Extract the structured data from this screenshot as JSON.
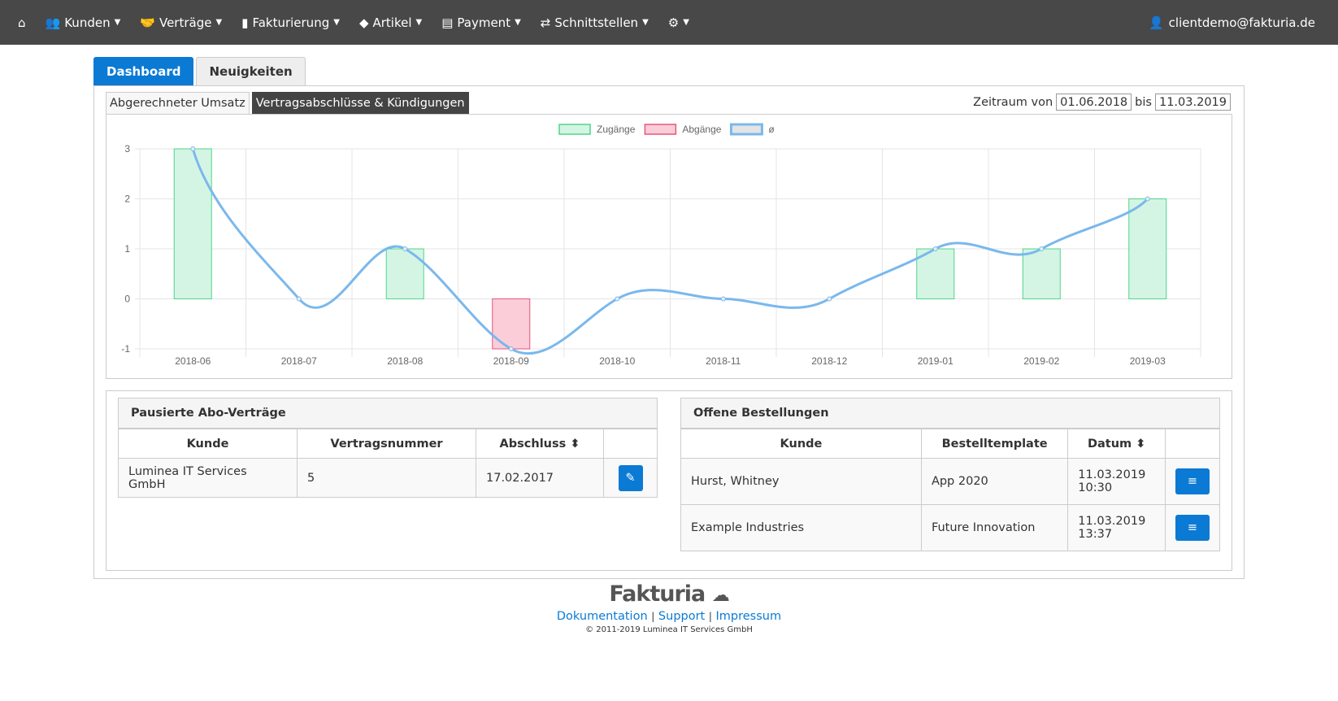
{
  "nav": {
    "items": [
      {
        "label": "Kunden",
        "icon": "users-icon"
      },
      {
        "label": "Verträge",
        "icon": "handshake-icon"
      },
      {
        "label": "Fakturierung",
        "icon": "book-icon"
      },
      {
        "label": "Artikel",
        "icon": "tags-icon"
      },
      {
        "label": "Payment",
        "icon": "credit-card-icon"
      },
      {
        "label": "Schnittstellen",
        "icon": "exchange-icon"
      }
    ],
    "user": "clientdemo@fakturia.de"
  },
  "tabs": [
    "Dashboard",
    "Neuigkeiten"
  ],
  "subtabs": [
    "Abgerechneter Umsatz",
    "Vertragsabschlüsse & Kündigungen"
  ],
  "range": {
    "label_from": "Zeitraum von",
    "from": "01.06.2018",
    "label_to": "bis",
    "to": "11.03.2019"
  },
  "chart_data": {
    "type": "bar",
    "categories": [
      "2018-06",
      "2018-07",
      "2018-08",
      "2018-09",
      "2018-10",
      "2018-11",
      "2018-12",
      "2019-01",
      "2019-02",
      "2019-03"
    ],
    "series": [
      {
        "name": "Zugänge",
        "type": "bar",
        "values": [
          3,
          0,
          1,
          0,
          0,
          0,
          0,
          1,
          1,
          2
        ],
        "color": "#d4f5e4",
        "border": "#4fd58a"
      },
      {
        "name": "Abgänge",
        "type": "bar",
        "values": [
          0,
          0,
          0,
          -1,
          0,
          0,
          0,
          0,
          0,
          0
        ],
        "color": "#fbcdd8",
        "border": "#e8557a"
      },
      {
        "name": "ø",
        "type": "line",
        "values": [
          3,
          0,
          1,
          -1,
          0,
          0,
          0,
          1,
          1,
          2
        ],
        "color": "#7ab8ec"
      }
    ],
    "ylim": [
      -1,
      3
    ],
    "yticks": [
      "3",
      "2",
      "1",
      "0",
      "-1"
    ],
    "grid": true,
    "legend": "top"
  },
  "paused": {
    "title": "Pausierte Abo-Verträge",
    "headers": [
      "Kunde",
      "Vertragsnummer",
      "Abschluss ⬍",
      ""
    ],
    "rows": [
      [
        "Luminea IT Services GmbH",
        "5",
        "17.02.2017"
      ]
    ]
  },
  "orders": {
    "title": "Offene Bestellungen",
    "headers": [
      "Kunde",
      "Bestelltemplate",
      "Datum ⬍",
      ""
    ],
    "rows": [
      [
        "Hurst, Whitney",
        "App 2020",
        "11.03.2019",
        "10:30"
      ],
      [
        "Example Industries",
        "Future Innovation",
        "11.03.2019",
        "13:37"
      ]
    ]
  },
  "footer": {
    "logo": "Fakturia",
    "links": [
      "Dokumentation",
      "Support",
      "Impressum"
    ],
    "copyright": "© 2011-2019 Luminea IT Services GmbH"
  }
}
